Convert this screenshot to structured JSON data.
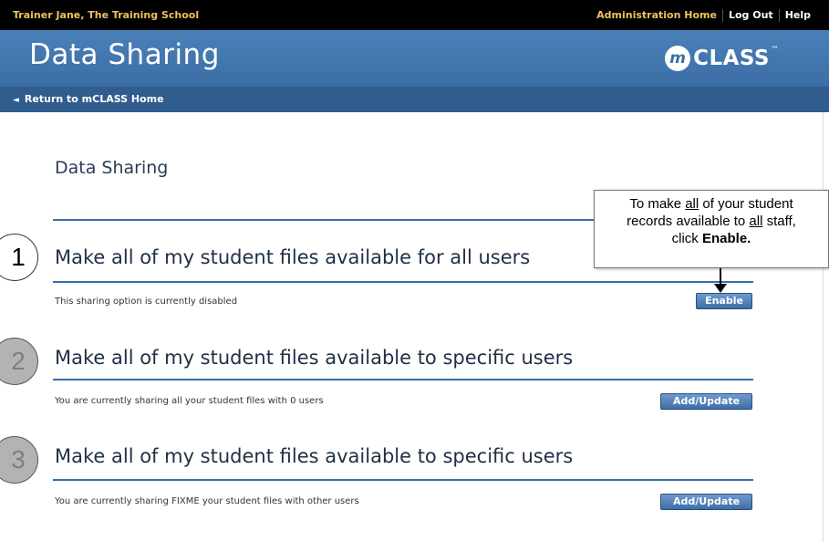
{
  "topbar": {
    "user": "Trainer Jane, The Training School",
    "links": [
      "Administration Home",
      "Log Out",
      "Help"
    ]
  },
  "header": {
    "title": "Data Sharing",
    "logo_mark": "m",
    "logo_word": "CLASS",
    "logo_tm": "™"
  },
  "subbar": {
    "return_link": "Return to mCLASS Home",
    "arrow_icon": "◄"
  },
  "page": {
    "title": "Data Sharing"
  },
  "sections": [
    {
      "step": "1",
      "title": "Make all of my student files available for all users",
      "status": "This sharing option is currently disabled",
      "button": "Enable"
    },
    {
      "step": "2",
      "title": "Make all of my student files available to specific users",
      "status": "You are currently sharing all your student files with 0 users",
      "button": "Add/Update"
    },
    {
      "step": "3",
      "title": "Make all of my student files available to specific users",
      "status": "You are currently sharing FIXME your student files with other users",
      "button": "Add/Update"
    }
  ],
  "callout": {
    "line1_pre": "To make ",
    "line1_u": "all",
    "line1_post": " of your student",
    "line2_pre": "records available to ",
    "line2_u": "all",
    "line2_post": " staff,",
    "line3_pre": "click ",
    "line3_bold": "Enable."
  }
}
